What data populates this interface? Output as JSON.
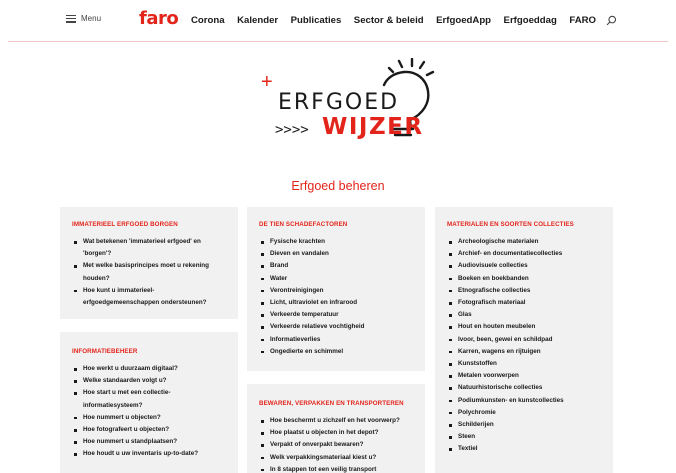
{
  "header": {
    "menu_label": "Menu",
    "logo": "faro",
    "nav": [
      "Corona",
      "Kalender",
      "Publicaties",
      "Sector & beleid",
      "ErfgoedApp",
      "Erfgoeddag",
      "FARO"
    ]
  },
  "brand": {
    "line1": "ERFGOED",
    "line2": "WIJZER",
    "arrows": ">>>>",
    "plus": "+"
  },
  "section_title": "Erfgoed beheren",
  "cards": {
    "immaterieel": {
      "title": "IMMATERIEEL ERFGOED BORGEN",
      "items": [
        "Wat betekenen 'immaterieel erfgoed' en 'borgen'?",
        "Met welke basisprincipes moet u rekening houden?",
        "Hoe kunt u immaterieel-erfgoedgemeenschappen ondersteunen?"
      ]
    },
    "informatiebeheer": {
      "title": "INFORMATIEBEHEER",
      "items": [
        "Hoe werkt u duurzaam digitaal?",
        "Welke standaarden volgt u?",
        "Hoe start u met een collectie-informatiesysteem?",
        "Hoe nummert u objecten?",
        "Hoe fotografeert u objecten?",
        "Hoe nummert u standplaatsen?",
        "Hoe houdt u uw inventaris up-to-date?"
      ]
    },
    "schadefactoren": {
      "title": "DE TIEN SCHADEFACTOREN",
      "items": [
        "Fysische krachten",
        "Dieven en vandalen",
        "Brand",
        "Water",
        "Verontreinigingen",
        "Licht, ultraviolet en infrarood",
        "Verkeerde temperatuur",
        "Verkeerde relatieve vochtigheid",
        "Informatieverlies",
        "Ongedierte en schimmel"
      ]
    },
    "bewaren": {
      "title": "BEWAREN, VERPAKKEN EN TRANSPORTEREN",
      "items": [
        "Hoe beschermt u zichzelf en het voorwerp?",
        "Hoe plaatst u objecten in het depot?",
        "Verpakt of onverpakt bewaren?",
        "Welk verpakkingsmateriaal kiest u?",
        "In 8 stappen tot een veilig transport"
      ]
    },
    "materialen": {
      "title": "MATERIALEN EN SOORTEN COLLECTIES",
      "items": [
        "Archeologische materialen",
        "Archief- en documentatiecollecties",
        "Audiovisuele collecties",
        "Boeken en boekbanden",
        "Etnografische collecties",
        "Fotografisch materiaal",
        "Glas",
        "Hout en houten meubelen",
        "Ivoor, been, gewei en schildpad",
        "Karren, wagens en rijtuigen",
        "Kunststoffen",
        "Metalen voorwerpen",
        "Natuurhistorische collecties",
        "Podiumkunsten- en kunstcollecties",
        "Polychromie",
        "Schilderijen",
        "Steen",
        "Textiel"
      ]
    }
  },
  "colors": {
    "accent": "#e3241b",
    "card_bg": "#f1f1f1",
    "text": "#1a1a1a"
  }
}
